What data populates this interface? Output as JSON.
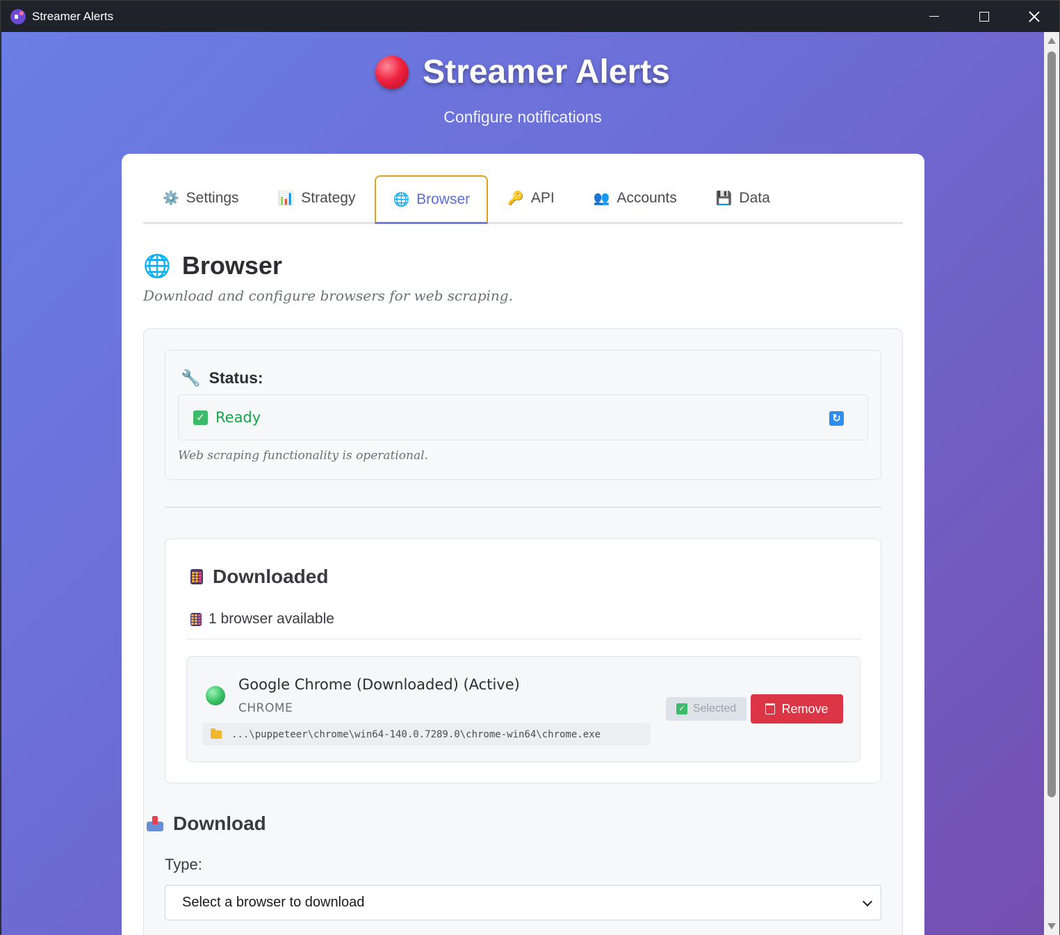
{
  "window": {
    "title": "Streamer Alerts"
  },
  "header": {
    "title": "Streamer Alerts",
    "subtitle": "Configure notifications"
  },
  "tabs": [
    {
      "icon": "⚙️",
      "label": "Settings"
    },
    {
      "icon": "📊",
      "label": "Strategy"
    },
    {
      "icon": "🌐",
      "label": "Browser"
    },
    {
      "icon": "🔑",
      "label": "API"
    },
    {
      "icon": "👥",
      "label": "Accounts"
    },
    {
      "icon": "💾",
      "label": "Data"
    }
  ],
  "active_tab": "Browser",
  "section": {
    "icon": "🌐",
    "title": "Browser",
    "description": "Download and configure browsers for web scraping."
  },
  "status": {
    "icon": "🔧",
    "label": "Status:",
    "value": "Ready",
    "note": "Web scraping functionality is operational."
  },
  "downloaded": {
    "title": "Downloaded",
    "count_text": "1 browser available",
    "browsers": [
      {
        "name": "Google Chrome (Downloaded) (Active)",
        "type": "CHROME",
        "path": "...\\puppeteer\\chrome\\win64-140.0.7289.0\\chrome-win64\\chrome.exe",
        "selected_label": "Selected",
        "remove_label": "Remove"
      }
    ]
  },
  "download": {
    "title": "Download",
    "type_label": "Type:",
    "select_value": "Select a browser to download"
  },
  "colors": {
    "accent": "#6b7ee0",
    "success": "#17a34a",
    "danger": "#dc3545",
    "focus": "#e0a11b"
  }
}
